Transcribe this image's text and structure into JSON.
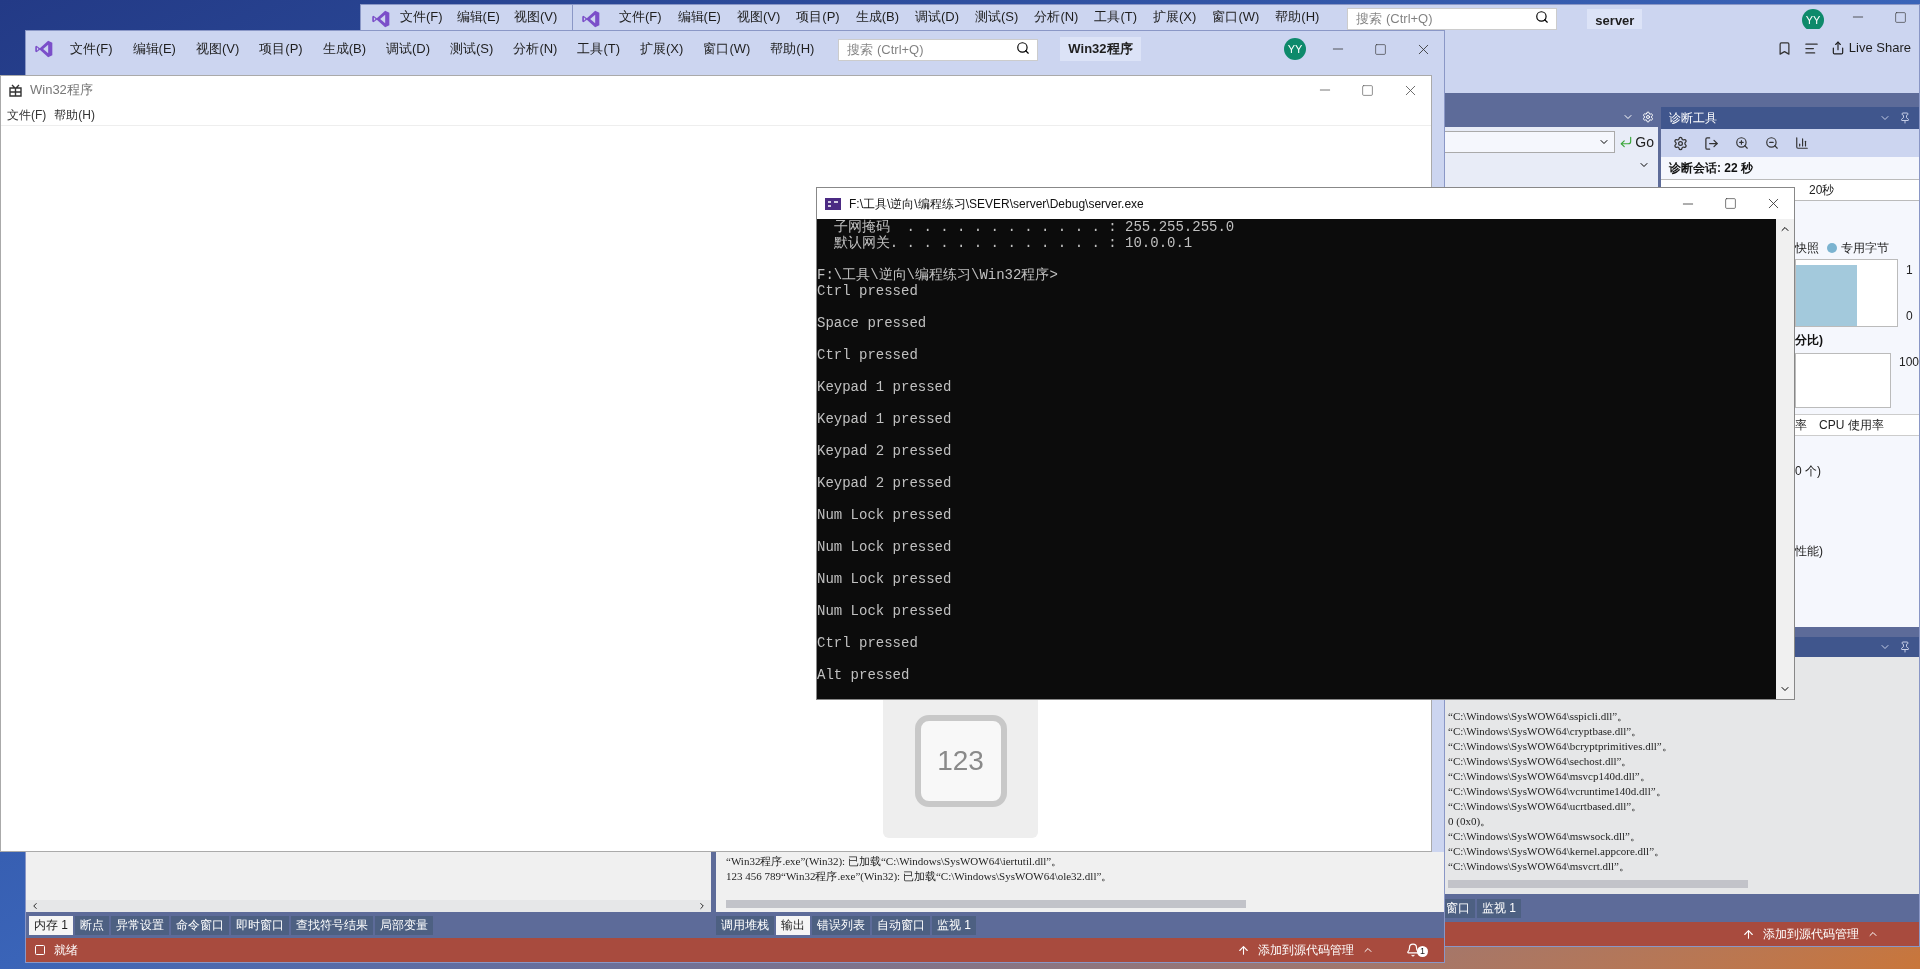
{
  "back_window": {
    "menu": [
      "文件(F)",
      "编辑(E)",
      "视图(V)"
    ]
  },
  "server_ide": {
    "menu": [
      "文件(F)",
      "编辑(E)",
      "视图(V)",
      "项目(P)",
      "生成(B)",
      "调试(D)",
      "测试(S)",
      "分析(N)",
      "工具(T)",
      "扩展(X)",
      "窗口(W)",
      "帮助(H)"
    ],
    "search": {
      "placeholder": "搜索 (Ctrl+Q)"
    },
    "solution": "server",
    "avatar": "YY",
    "live_share": "Live Share",
    "go_button": "Go",
    "diagnostics": {
      "title": "诊断工具",
      "session": "诊断会话: 22 秒",
      "timeline_label": "20秒",
      "legend": [
        {
          "label": "快照"
        },
        {
          "label": "专用字节",
          "color": "#7bb3d0"
        }
      ],
      "memory_chart": {
        "axis": [
          "1",
          "0"
        ],
        "level": 0.6
      },
      "cpu_heading": "分比)",
      "cpu_axis": "100",
      "tabs": [
        {
          "label": "率",
          "selected": false
        },
        {
          "label": "CPU 使用率",
          "selected": false
        }
      ],
      "rows": [
        "0 个)",
        "性能)"
      ]
    },
    "output_lines": [
      "“C:\\Windows\\SysWOW64\\sspicli.dll”。",
      "“C:\\Windows\\SysWOW64\\cryptbase.dll”。",
      "“C:\\Windows\\SysWOW64\\bcryptprimitives.dll”。",
      "“C:\\Windows\\SysWOW64\\sechost.dll”。",
      "“C:\\Windows\\SysWOW64\\msvcp140d.dll”。",
      "“C:\\Windows\\SysWOW64\\vcruntime140d.dll”。",
      "“C:\\Windows\\SysWOW64\\ucrtbased.dll”。",
      "0 (0x0)。",
      "“C:\\Windows\\SysWOW64\\mswsock.dll”。",
      "“C:\\Windows\\SysWOW64\\kernel.appcore.dll”。",
      "“C:\\Windows\\SysWOW64\\msvcrt.dll”。"
    ],
    "tabs": [
      {
        "label": "窗口",
        "selected": false
      },
      {
        "label": "监视 1",
        "selected": false
      }
    ],
    "status_bar": {
      "source_control": "添加到源代码管理"
    }
  },
  "front_ide": {
    "menu": [
      "文件(F)",
      "编辑(E)",
      "视图(V)",
      "项目(P)",
      "生成(B)",
      "调试(D)",
      "测试(S)",
      "分析(N)",
      "工具(T)",
      "扩展(X)",
      "窗口(W)",
      "帮助(H)"
    ],
    "search": {
      "placeholder": "搜索 (Ctrl+Q)"
    },
    "solution": "Win32程序",
    "avatar": "YY",
    "left_tabs": [
      {
        "label": "内存 1",
        "selected": true
      },
      {
        "label": "断点",
        "selected": false
      },
      {
        "label": "异常设置",
        "selected": false
      },
      {
        "label": "命令窗口",
        "selected": false
      },
      {
        "label": "即时窗口",
        "selected": false
      },
      {
        "label": "查找符号结果",
        "selected": false
      },
      {
        "label": "局部变量",
        "selected": false
      }
    ],
    "output_lines": [
      "“Win32程序.exe”(Win32): 已加载“C:\\Windows\\SysWOW64\\iertutil.dll”。",
      "123 456 789“Win32程序.exe”(Win32): 已加载“C:\\Windows\\SysWOW64\\ole32.dll”。"
    ],
    "right_tabs": [
      {
        "label": "调用堆栈",
        "selected": false
      },
      {
        "label": "输出",
        "selected": true
      },
      {
        "label": "错误列表",
        "selected": false
      },
      {
        "label": "自动窗口",
        "selected": false
      },
      {
        "label": "监视 1",
        "selected": false
      }
    ],
    "status_bar": {
      "state": "就绪",
      "source_control": "添加到源代码管理",
      "notifications": "1"
    }
  },
  "app_window": {
    "title": "Win32程序",
    "menu": [
      "文件(F)",
      "帮助(H)"
    ]
  },
  "console": {
    "title": "F:\\工具\\逆向\\编程练习\\SEVER\\server\\Debug\\server.exe",
    "header_lines": [
      "  子网掩码  . . . . . . . . . . . . : 255.255.255.0",
      "  默认网关. . . . . . . . . . . . . : 10.0.0.1"
    ],
    "prompt": "F:\\工具\\逆向\\编程练习\\Win32程序>",
    "events": [
      "Ctrl pressed",
      "Space pressed",
      "Ctrl pressed",
      "Keypad 1 pressed",
      "Keypad 1 pressed",
      "Keypad 2 pressed",
      "Keypad 2 pressed",
      "Num Lock pressed",
      "Num Lock pressed",
      "Num Lock pressed",
      "Num Lock pressed",
      "Ctrl pressed",
      "Alt pressed"
    ]
  },
  "osd": {
    "text": "123"
  }
}
